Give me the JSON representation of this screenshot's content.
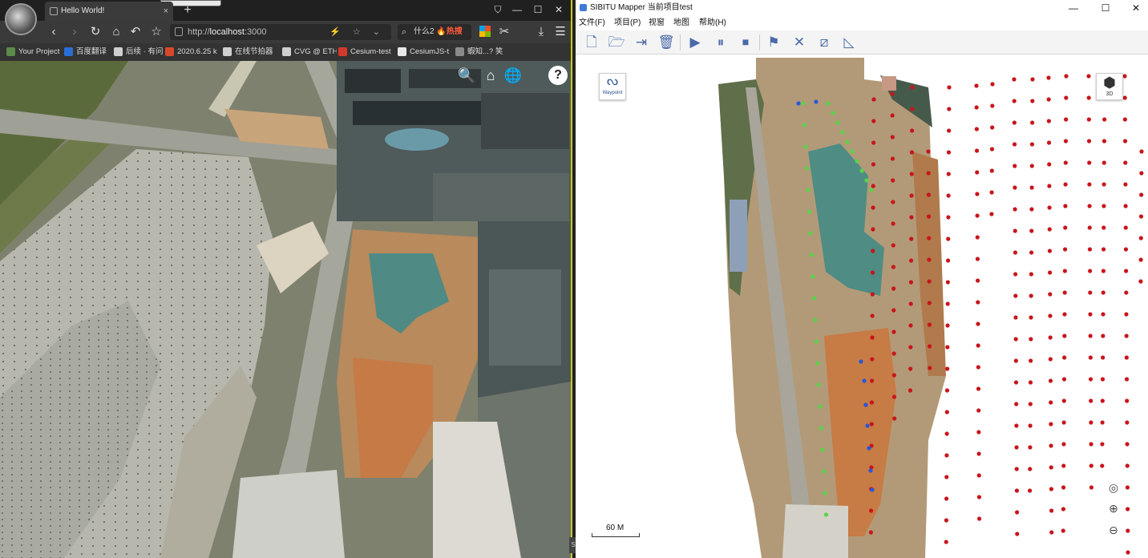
{
  "browser": {
    "tab_title": "Hello World!",
    "tab_close": "×",
    "new_tab": "+",
    "window_controls": [
      "⛉",
      "—",
      "☐",
      "✕"
    ],
    "nav": {
      "back": "‹",
      "forward": "›",
      "reload": "↻",
      "home": "⌂",
      "undo": "↶",
      "star": "☆"
    },
    "url_scheme": "http://",
    "url_host": "localhost",
    "url_port": ":3000",
    "url_icons": "⚡ ☆ ⌄",
    "search_text": "什么2",
    "search_hot": "🔥热搜",
    "right_icons": [
      "✂",
      "⤓",
      "☰"
    ],
    "bookmarks": [
      {
        "label": "Your Project",
        "color": "#5a8b4a"
      },
      {
        "label": "百度翻译",
        "color": "#2b6fd6"
      },
      {
        "label": "后续 · 有问",
        "color": "#cfcfcf"
      },
      {
        "label": "2020.6.25 k",
        "color": "#d9472b"
      },
      {
        "label": "在线节拍器",
        "color": "#cfcfcf"
      },
      {
        "label": "CVG @ ETH",
        "color": "#cfcfcf"
      },
      {
        "label": "Cesium-test",
        "color": "#d33a2c"
      },
      {
        "label": "CesiumJS-t",
        "color": "#e8e8e8"
      },
      {
        "label": "蝦知...? 笑",
        "color": "#8a8a8a"
      }
    ],
    "cesium_controls": [
      "search-icon",
      "home-icon",
      "globe-icon",
      "help-icon"
    ],
    "cesium_search": "🔍",
    "cesium_home": "⌂",
    "cesium_globe": "🌐",
    "cesium_help": "?"
  },
  "mapper": {
    "title": "SIBITU Mapper 当前项目test",
    "window_controls": [
      "—",
      "☐",
      "✕"
    ],
    "menu": [
      "文件(F)",
      "项目(P)",
      "视窗",
      "地图",
      "帮助(H)"
    ],
    "toolbar": [
      {
        "name": "new-project-icon",
        "glyph": "🗋"
      },
      {
        "name": "open-folder-icon",
        "glyph": "🗁"
      },
      {
        "name": "export-icon",
        "glyph": "⇥"
      },
      {
        "name": "delete-icon",
        "glyph": "🗑"
      },
      {
        "name": "play-icon",
        "glyph": "▶"
      },
      {
        "name": "pause-icon",
        "glyph": "⏸"
      },
      {
        "name": "stop-icon",
        "glyph": "⏹"
      },
      {
        "name": "flag-icon",
        "glyph": "⚑"
      },
      {
        "name": "cross-tool-icon",
        "glyph": "✕"
      },
      {
        "name": "crop-tool-icon",
        "glyph": "⧄"
      },
      {
        "name": "measure-tool-icon",
        "glyph": "◺"
      }
    ],
    "waypoint_glyph": "ᔓ",
    "waypoint_label": "Waypoint",
    "view3d_glyph": "⬢",
    "view3d_label": "3D",
    "locate_glyph": "◎",
    "zoom_in_glyph": "⊕",
    "zoom_out_glyph": "⊖",
    "scale_label": "60 M",
    "waypoint_colors": {
      "flight": "#c8151b",
      "green": "#5ad24a",
      "blue": "#2a57d8"
    }
  }
}
